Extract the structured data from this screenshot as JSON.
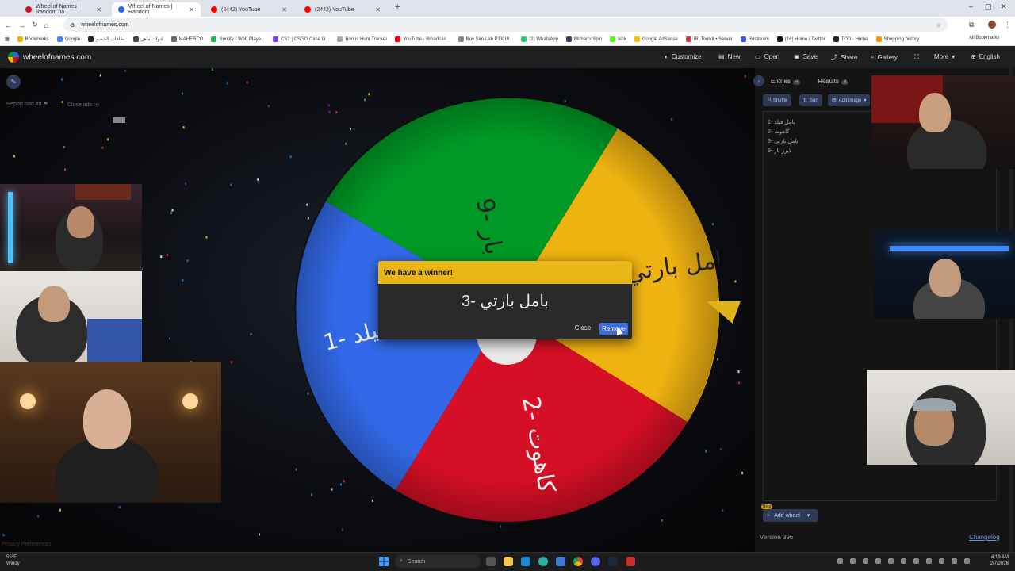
{
  "browser": {
    "tabs": [
      {
        "title": "Wheel of Names | Random na",
        "favicon_color": "#d50f25",
        "active": false
      },
      {
        "title": "Wheel of Names | Random",
        "favicon_color": "#3369e8",
        "active": true
      },
      {
        "title": "(2442) YouTube",
        "favicon_color": "#ff0000",
        "active": false
      },
      {
        "title": "(2442) YouTube",
        "favicon_color": "#ff0000",
        "active": false
      }
    ],
    "url": "wheelofnames.com",
    "bookmarks": [
      {
        "label": "Bookmarks",
        "color": "#f2b400"
      },
      {
        "label": "Google",
        "color": "#4285f4"
      },
      {
        "label": "بطاقات الخصم",
        "color": "#222222"
      },
      {
        "label": "ادوات ماهر",
        "color": "#444444"
      },
      {
        "label": "MAHERCO",
        "color": "#666666"
      },
      {
        "label": "Spotify - Web Playe...",
        "color": "#1db954"
      },
      {
        "label": "CS2 | CSGO Case O...",
        "color": "#7b3fe4"
      },
      {
        "label": "Bonus Hunt Tracker",
        "color": "#aaaaaa"
      },
      {
        "label": "YouTube - Broadcas...",
        "color": "#ff0000"
      },
      {
        "label": "Buy Sim-Lab P1X Ul...",
        "color": "#888888"
      },
      {
        "label": "(2) WhatsApp",
        "color": "#25d366"
      },
      {
        "label": "MahercoSpin",
        "color": "#334455"
      },
      {
        "label": "kick",
        "color": "#53fc18"
      },
      {
        "label": "Google AdSense",
        "color": "#fbbc04"
      },
      {
        "label": "IRLToolkit • Server",
        "color": "#d53c3c"
      },
      {
        "label": "Restream",
        "color": "#3b5bdb"
      },
      {
        "label": "(16) Home / Twitter",
        "color": "#111111"
      },
      {
        "label": "TOD - Home",
        "color": "#222222"
      },
      {
        "label": "Shopping history",
        "color": "#ff9900"
      }
    ],
    "all_bookmarks": "All Bookmarks"
  },
  "site": {
    "logo_text": "wheelofnames.com",
    "nav": [
      "Customize",
      "New",
      "Open",
      "Save",
      "Share",
      "Gallery",
      "More",
      "English"
    ]
  },
  "ads": {
    "report": "Report bad ad",
    "close": "Close ads"
  },
  "privacy": "Privacy Preferences",
  "panel": {
    "tabs": [
      {
        "label": "Entries",
        "count": "4"
      },
      {
        "label": "Results",
        "count": "0"
      }
    ],
    "buttons": [
      "Shuffle",
      "Sort",
      "Add image"
    ],
    "entries": [
      "1- بامل فيلد",
      "2- كاهوت",
      "3- بامل بارتي",
      "9- لايرز بار"
    ],
    "add_wheel": "Add wheel",
    "beta": "Beta",
    "version": "Version 396",
    "changelog": "Changelog"
  },
  "wheel": {
    "segments": [
      {
        "label": "9- لايرز بار",
        "color": "#009925"
      },
      {
        "label": "بامل بارتي",
        "color": "#eeb211"
      },
      {
        "label": "2- كاهوت",
        "color": "#d50f25"
      },
      {
        "label": "1- بامل فيلد",
        "color": "#3369e8"
      }
    ]
  },
  "dialog": {
    "heading": "We have a winner!",
    "winner": "3- بامل بارتي",
    "close": "Close",
    "remove": "Remove"
  },
  "taskbar": {
    "weather_temp": "55°F",
    "weather_desc": "Windy",
    "search": "Search",
    "time": "4:19 AM",
    "date": "2/7/2026"
  }
}
